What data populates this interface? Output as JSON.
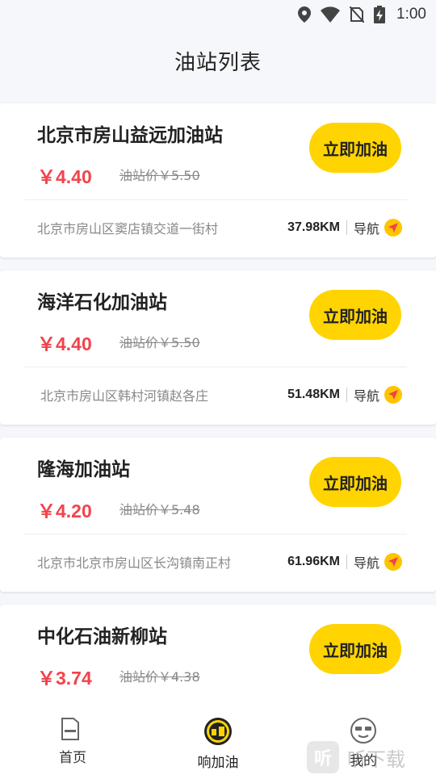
{
  "status_bar": {
    "time": "1:00"
  },
  "header": {
    "title": "油站列表"
  },
  "stations": [
    {
      "name": "北京市房山益远加油站",
      "price": "￥4.40",
      "original_price": "油站价￥5.50",
      "button": "立即加油",
      "address": "北京市房山区窦店镇交道一街村",
      "distance": "37.98KM",
      "nav_label": "导航"
    },
    {
      "name": "海洋石化加油站",
      "price": "￥4.40",
      "original_price": "油站价￥5.50",
      "button": "立即加油",
      "address": "北京市房山区韩村河镇赵各庄",
      "distance": "51.48KM",
      "nav_label": "导航"
    },
    {
      "name": "隆海加油站",
      "price": "￥4.20",
      "original_price": "油站价￥5.48",
      "button": "立即加油",
      "address": "北京市北京市房山区长沟镇南正村",
      "distance": "61.96KM",
      "nav_label": "导航"
    },
    {
      "name": "中化石油新柳站",
      "price": "￥3.74",
      "original_price": "油站价￥4.38",
      "button": "立即加油",
      "address": "",
      "distance": "",
      "nav_label": ""
    }
  ],
  "bottom_nav": {
    "tabs": [
      {
        "label": "首页",
        "icon": "home-icon"
      },
      {
        "label": "响加油",
        "icon": "brand-logo-icon"
      },
      {
        "label": "我的",
        "icon": "profile-icon"
      }
    ],
    "active_tab": 1
  },
  "watermark": {
    "text": "听下载",
    "logo_glyph": "听"
  },
  "colors": {
    "accent": "#ffd400",
    "price": "#f2434c",
    "background": "#f6f7fa"
  }
}
